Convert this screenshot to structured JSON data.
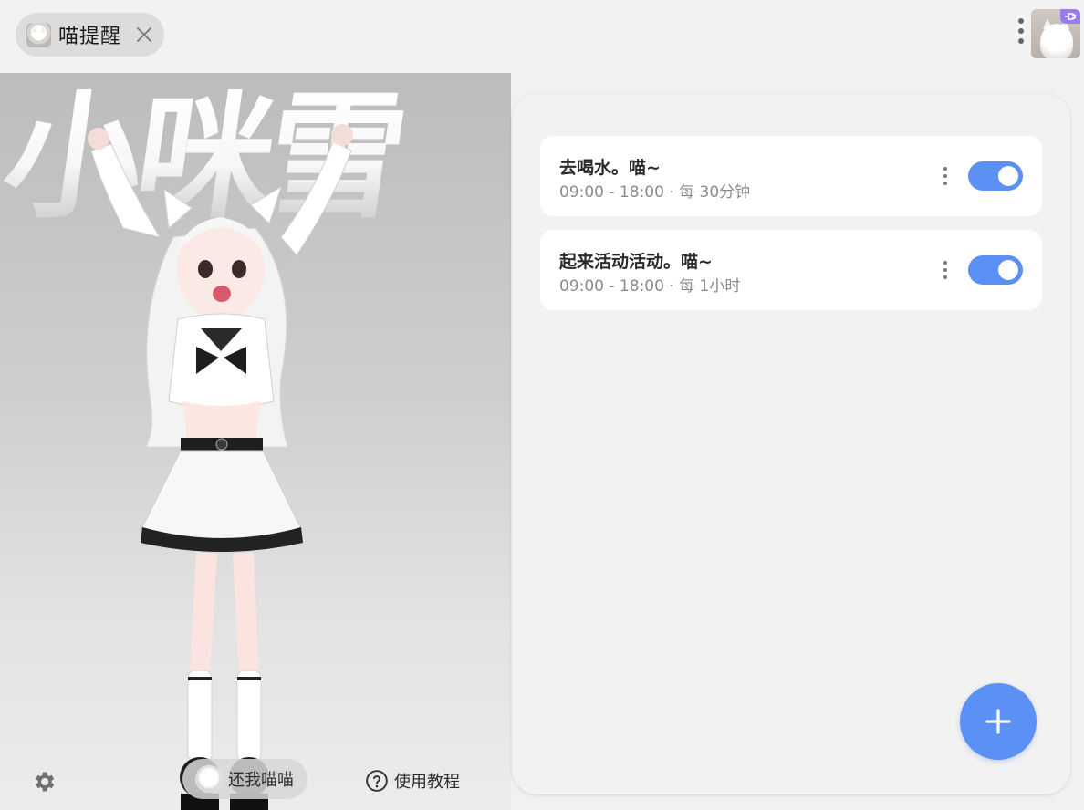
{
  "header": {
    "tab_label": "喵提醒",
    "tab_avatar_icon": "white-cat-avatar-icon",
    "close_icon": "close-icon",
    "menu_icon": "more-vertical-icon",
    "corner_avatar_icon": "white-cat-avatar-icon",
    "corner_badge_icon": "plug-icon",
    "badge_color": "#9a7cf0"
  },
  "hero": {
    "title": "小咪雪",
    "settings_icon": "gear-icon",
    "meow_button_label": "还我喵喵",
    "help_icon": "question-circle-icon",
    "help_label": "使用教程"
  },
  "reminders": [
    {
      "title": "去喝水。喵~",
      "schedule": "09:00 - 18:00 · 每 30分钟",
      "enabled": true
    },
    {
      "title": "起来活动活动。喵~",
      "schedule": "09:00 - 18:00 · 每 1小时",
      "enabled": true
    }
  ],
  "fab": {
    "icon": "plus-icon"
  },
  "colors": {
    "accent": "#5b91f5",
    "panel_bg": "#f2f2f3",
    "card_bg": "#ffffff"
  }
}
